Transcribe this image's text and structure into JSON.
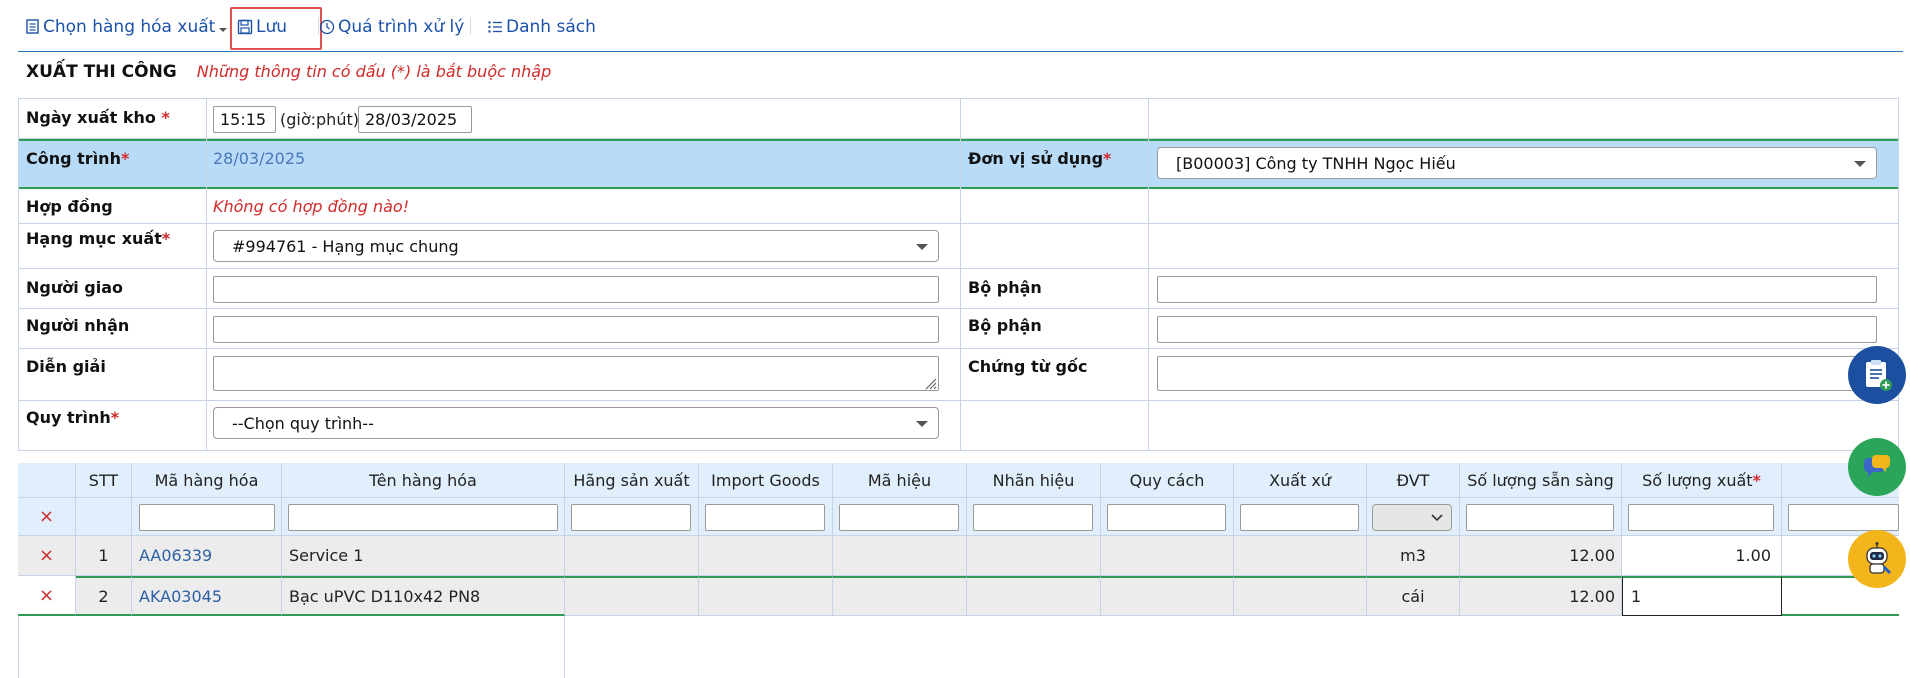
{
  "toolbar": {
    "select_goods": "Chọn hàng hóa xuất",
    "save": "Lưu",
    "process": "Quá trình xử lý",
    "list": "Danh sách"
  },
  "header": {
    "title": "XUẤT THI CÔNG",
    "note": "Những thông tin có dấu (*) là bắt buộc nhập"
  },
  "form": {
    "export_date_label": "Ngày xuất kho",
    "required_mark": "*",
    "time_value": "15:15",
    "time_hint": "(giờ:phút)",
    "date_value": "28/03/2025",
    "project_label": "Công trình",
    "project_value": "28/03/2025",
    "unit_label": "Đơn vị sử dụng",
    "unit_value": "[B00003] Công ty TNHH Ngọc Hiếu",
    "contract_label": "Hợp đồng",
    "contract_value": "Không có hợp đồng nào!",
    "category_label": "Hạng mục xuất",
    "category_value": "#994761 - Hạng mục chung",
    "deliverer_label": "Người giao",
    "deliverer_value": "",
    "department_label": "Bộ phận",
    "department_value": "",
    "receiver_label": "Người nhận",
    "receiver_value": "",
    "department2_label": "Bộ phận",
    "department2_value": "",
    "description_label": "Diễn giải",
    "description_value": "",
    "source_doc_label": "Chứng từ gốc",
    "source_doc_value": "",
    "workflow_label": "Quy trình",
    "workflow_value": "--Chọn quy trình--"
  },
  "grid": {
    "headers": [
      "STT",
      "Mã hàng hóa",
      "Tên hàng hóa",
      "Hãng sản xuất",
      "Import Goods",
      "Mã hiệu",
      "Nhãn hiệu",
      "Quy cách",
      "Xuất xứ",
      "ĐVT",
      "Số lượng sẵn sàng",
      "Số lượng xuất"
    ],
    "rows": [
      {
        "stt": "1",
        "code": "AA06339",
        "name": "Service 1",
        "unit": "m3",
        "available": "12.00",
        "qty": "1.00"
      },
      {
        "stt": "2",
        "code": "AKA03045",
        "name": "Bạc uPVC D110x42 PN8",
        "unit": "cái",
        "available": "12.00",
        "qty": "1"
      }
    ],
    "delete_symbol": "×"
  },
  "icons": {
    "select": "list-box-icon",
    "save": "floppy-disk-icon",
    "process": "clock-icon",
    "list": "bullet-list-icon",
    "delete": "x-icon",
    "clipboard": "clipboard-add-icon",
    "chat": "chat-bubble-icon",
    "bot": "robot-support-icon"
  },
  "colors": {
    "accent": "#1c52a8",
    "required": "#d12b2b",
    "highlight_row": "#b8dbf8",
    "grid_header": "#e1eefb"
  }
}
